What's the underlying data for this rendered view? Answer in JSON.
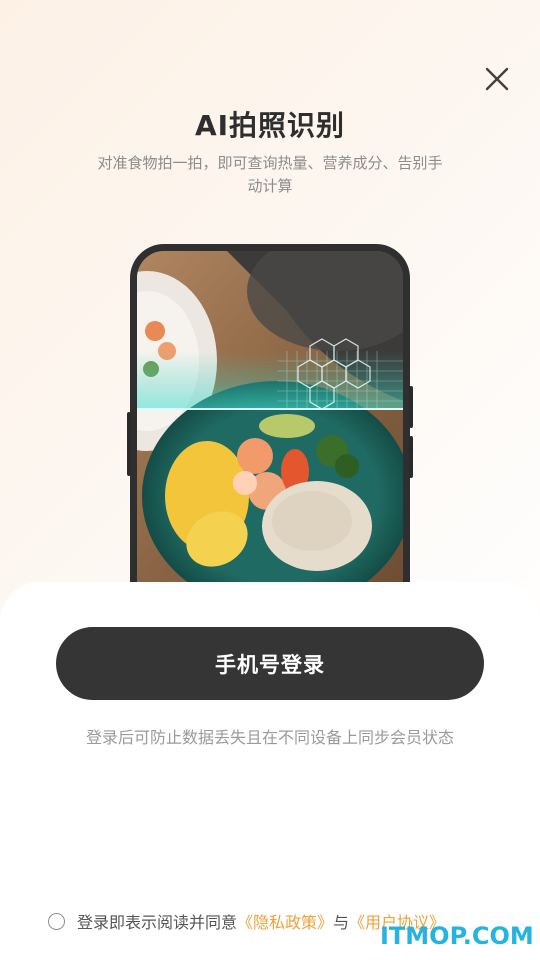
{
  "header": {
    "title": "AI拍照识别",
    "subtitle": "对准食物拍一拍，即可查询热量、营养成分、告别手动计算",
    "close_icon": "close-icon"
  },
  "illustration": {
    "icon": "phone-scanning-food-illustration"
  },
  "login": {
    "phone_login_label": "手机号登录",
    "hint": "登录后可防止数据丢失且在不同设备上同步会员状态"
  },
  "agreement": {
    "prefix": "登录即表示阅读并同意",
    "privacy_label": "《隐私政策》",
    "conjunction": "与",
    "user_agreement_label": "《用户协议》"
  },
  "watermark": {
    "text": "ITMOP.COM"
  },
  "colors": {
    "accent": "#f0a13a",
    "button": "#353535",
    "watermark": "#27b3e0"
  }
}
